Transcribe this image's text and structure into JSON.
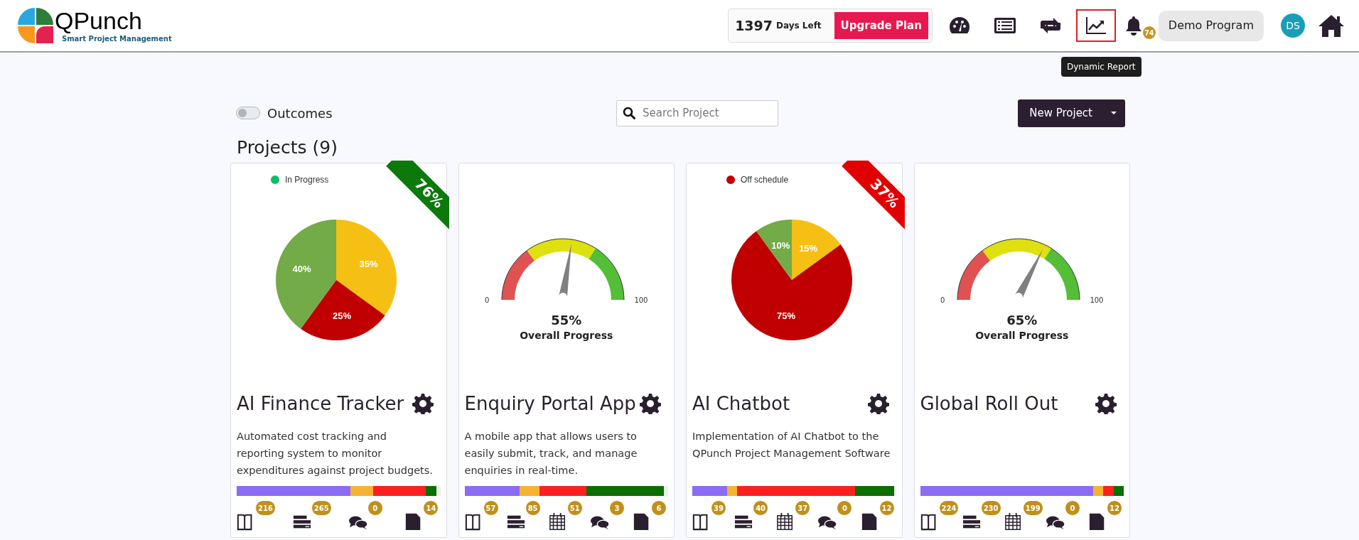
{
  "header": {
    "logo": {
      "name": "QPunch",
      "tagline": "Smart Project Management"
    },
    "plan": {
      "days": "1397",
      "days_label": "Days Left",
      "upgrade": "Upgrade Plan"
    },
    "nav_icons": [
      {
        "kind": "dashboard",
        "selected": false
      },
      {
        "kind": "list",
        "selected": false
      },
      {
        "kind": "repeat",
        "selected": false
      },
      {
        "kind": "report",
        "selected": true
      }
    ],
    "notifications": {
      "count": "74"
    },
    "program": "Demo Program",
    "avatar": "DS"
  },
  "tooltip": "Dynamic Report",
  "toolbar": {
    "outcomes": {
      "label": "Outcomes",
      "on": false
    },
    "search": {
      "placeholder": "Search Project"
    },
    "new_project": "New Project"
  },
  "title": "Projects (9)",
  "projects": [
    {
      "name": "AI Finance Tracker",
      "kind": "pie",
      "status": {
        "label": "In Progress",
        "color": "#0bbf64"
      },
      "ribbon": {
        "text": "76%",
        "color": "#0b7a0b"
      },
      "chart_data": {
        "type": "pie",
        "values": [
          35,
          25,
          40
        ],
        "value_labels": [
          "35%",
          "25%",
          "40%"
        ]
      },
      "description": "Automated cost tracking and reporting system to monitor expenditures against project budgets.",
      "bar": [
        {
          "color": "#8b6cf4"
        },
        {
          "color": "#f6b232"
        },
        {
          "color": "#fd2020"
        },
        {
          "color": "#0b6e00"
        }
      ],
      "counts": [
        {
          "kind": "book",
          "count": "216"
        },
        {
          "kind": "stack",
          "count": "265"
        },
        {
          "kind": "chat",
          "count": "0"
        },
        {
          "kind": "doc",
          "count": "14"
        }
      ]
    },
    {
      "name": "Enquiry Portal App",
      "kind": "gauge",
      "gauge": {
        "min": "0",
        "max": "100",
        "value": "55%",
        "label": "Overall Progress"
      },
      "description": "A mobile app that allows users to easily submit, track, and manage enquiries in real-time.",
      "bar": [
        {
          "color": "#8b6cf4"
        },
        {
          "color": "#f6b232"
        },
        {
          "color": "#fd2020"
        },
        {
          "color": "#0b6e00"
        }
      ],
      "counts": [
        {
          "kind": "book",
          "count": "57"
        },
        {
          "kind": "stack",
          "count": "85"
        },
        {
          "kind": "calendar",
          "count": "51"
        },
        {
          "kind": "chat",
          "count": "3"
        },
        {
          "kind": "doc",
          "count": "6"
        }
      ]
    },
    {
      "name": "AI Chatbot",
      "kind": "pie",
      "status": {
        "label": "Off schedule",
        "color": "#c00000"
      },
      "ribbon": {
        "text": "37%",
        "color": "#e00000"
      },
      "chart_data": {
        "type": "pie",
        "values": [
          15,
          75,
          10
        ],
        "value_labels": [
          "15%",
          "75%",
          "10%"
        ]
      },
      "description": "Implementation of AI Chatbot to the QPunch Project Management Software",
      "bar": [
        {
          "color": "#8b6cf4"
        },
        {
          "color": "#f6b232"
        },
        {
          "color": "#fd2020"
        },
        {
          "color": "#0b6e00"
        }
      ],
      "counts": [
        {
          "kind": "book",
          "count": "39"
        },
        {
          "kind": "stack",
          "count": "40"
        },
        {
          "kind": "calendar",
          "count": "37"
        },
        {
          "kind": "chat",
          "count": "0"
        },
        {
          "kind": "doc",
          "count": "12"
        }
      ]
    },
    {
      "name": "Global Roll Out",
      "kind": "gauge",
      "gauge": {
        "min": "0",
        "max": "100",
        "value": "65%",
        "label": "Overall Progress"
      },
      "bar": [
        {
          "color": "#8b6cf4"
        },
        {
          "color": "#f6b232"
        },
        {
          "color": "#fd2020"
        },
        {
          "color": "#0b6e00"
        }
      ],
      "counts": [
        {
          "kind": "book",
          "count": "224"
        },
        {
          "kind": "stack",
          "count": "230"
        },
        {
          "kind": "calendar",
          "count": "199"
        },
        {
          "kind": "chat",
          "count": "0"
        },
        {
          "kind": "doc",
          "count": "12"
        }
      ]
    }
  ]
}
